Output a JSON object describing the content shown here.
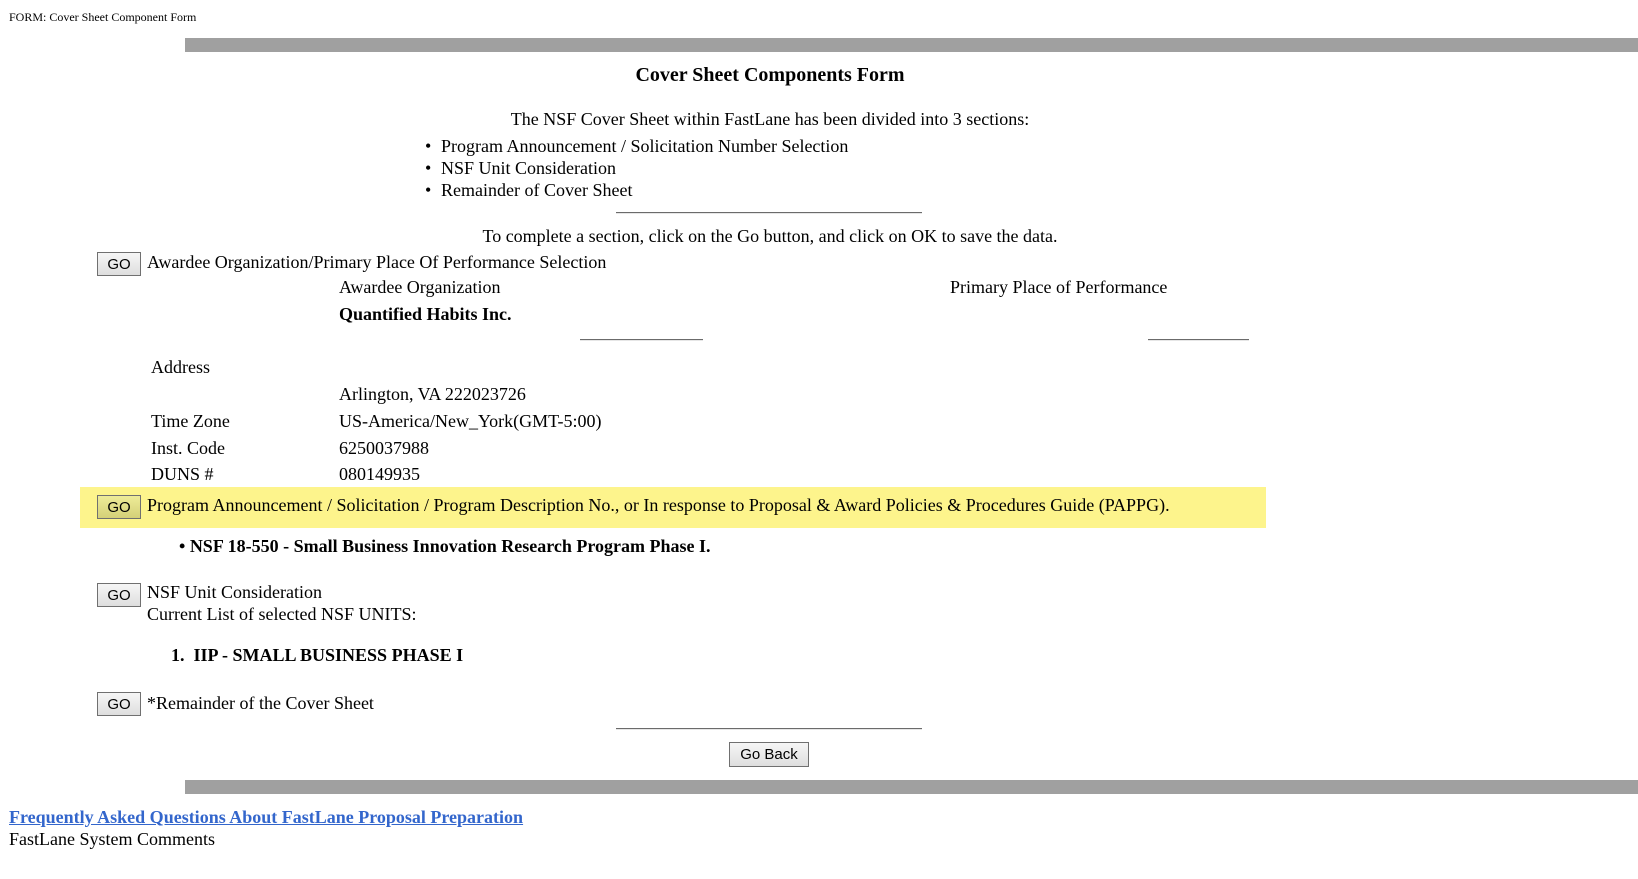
{
  "window": {
    "form_label": "FORM: Cover Sheet Component Form"
  },
  "header": {
    "title": "Cover Sheet Components Form",
    "intro": "The NSF Cover Sheet within FastLane has been divided into 3 sections:",
    "sections": [
      "Program Announcement / Solicitation Number Selection",
      "NSF Unit Consideration",
      "Remainder of Cover Sheet"
    ],
    "instructions": "To complete a section, click on the Go button, and click on OK to save the data."
  },
  "go_label": "GO",
  "awardee_section": {
    "label": "Awardee Organization/Primary Place Of Performance Selection",
    "awardee_org_heading": "Awardee Organization",
    "awardee_org_name": "Quantified Habits Inc.",
    "primary_place_heading": "Primary Place of Performance",
    "fields": [
      {
        "label": "Address",
        "value": ""
      },
      {
        "label": "",
        "value": "Arlington, VA 222023726"
      },
      {
        "label": "Time Zone",
        "value": "US-America/New_York(GMT-5:00)"
      },
      {
        "label": "Inst. Code",
        "value": "6250037988"
      },
      {
        "label": "DUNS #",
        "value": "080149935"
      }
    ]
  },
  "program_section": {
    "label": "Program Announcement / Solicitation / Program Description No., or In response to Proposal & Award Policies & Procedures Guide (PAPPG).",
    "selected": "NSF 18-550 - Small Business Innovation Research Program Phase I.",
    "highlight_color": "#fdf48c"
  },
  "unit_section": {
    "label": "NSF Unit Consideration",
    "sublabel": "Current List of selected NSF UNITS:",
    "units": [
      "IIP - SMALL BUSINESS PHASE I"
    ]
  },
  "remainder_section": {
    "label": "*Remainder of the Cover Sheet"
  },
  "footer": {
    "go_back_label": "Go Back",
    "faq_link": "Frequently Asked Questions About FastLane Proposal Preparation",
    "comments": "FastLane System Comments"
  }
}
